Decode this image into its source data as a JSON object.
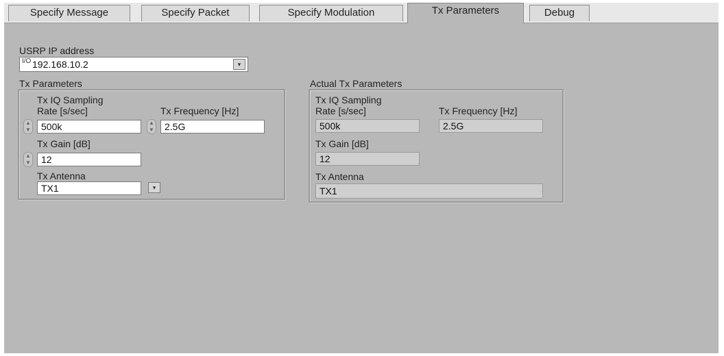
{
  "tabs": [
    {
      "label": "Specify Message"
    },
    {
      "label": "Specify Packet"
    },
    {
      "label": "Specify Modulation"
    },
    {
      "label": "Tx Parameters"
    },
    {
      "label": "Debug"
    }
  ],
  "usrp": {
    "label": "USRP IP address",
    "prefix_glyph": "I/O",
    "value": "192.168.10.2",
    "dropdown_glyph": "▾"
  },
  "tx_params": {
    "title": "Tx Parameters",
    "rate_label_line1": "Tx IQ Sampling",
    "rate_label_line2": "Rate [s/sec]",
    "rate_value": "500k",
    "freq_label": "Tx Frequency [Hz]",
    "freq_value": "2.5G",
    "gain_label": "Tx Gain [dB]",
    "gain_value": "12",
    "antenna_label": "Tx Antenna",
    "antenna_value": "TX1",
    "antenna_dropdown_glyph": "▾"
  },
  "actual_tx": {
    "title": "Actual Tx Parameters",
    "rate_label_line1": "Tx IQ Sampling",
    "rate_label_line2": "Rate [s/sec]",
    "rate_value": "500k",
    "freq_label": "Tx Frequency [Hz]",
    "freq_value": "2.5G",
    "gain_label": "Tx Gain [dB]",
    "gain_value": "12",
    "antenna_label": "Tx Antenna",
    "antenna_value": "TX1"
  },
  "colors": {
    "panel_bg": "#b8b8b8",
    "tab_strip_bg": "#e8e8e8",
    "field_bg": "#ffffff",
    "readonly_field_bg": "#cfcfcf"
  }
}
